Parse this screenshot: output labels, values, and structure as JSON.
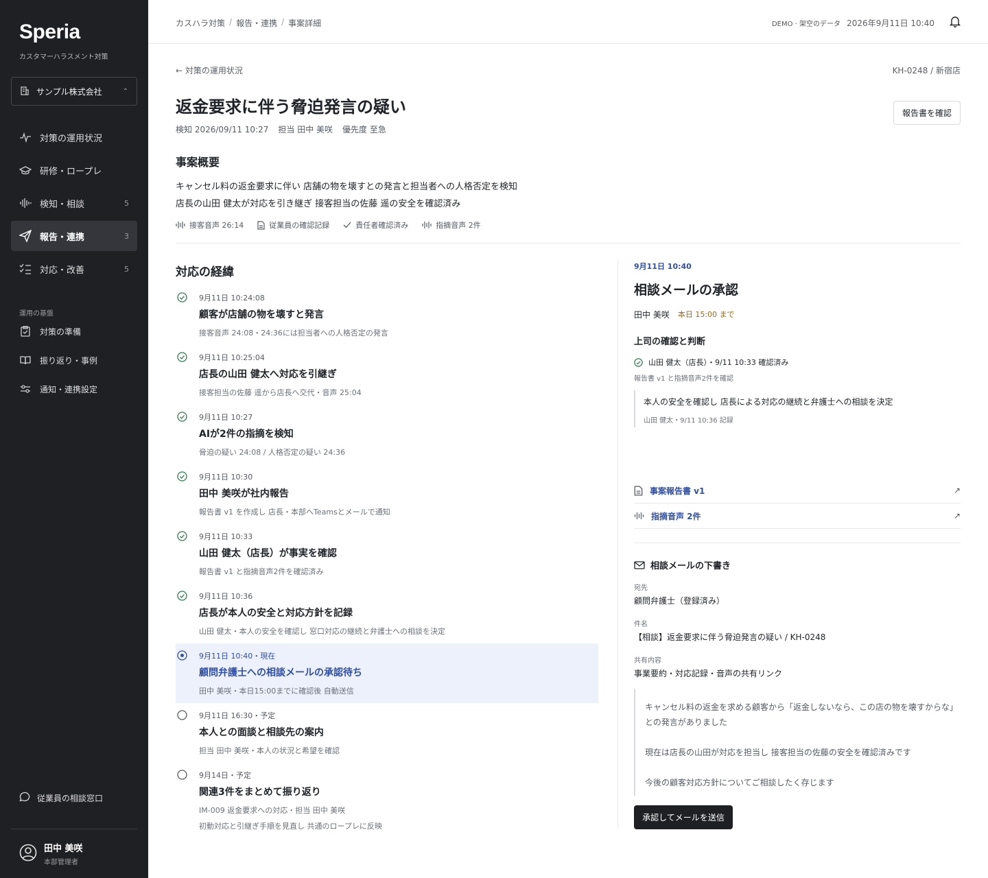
{
  "sidebar": {
    "logo": "Speria",
    "subtitle": "カスタマーハラスメント対策",
    "org": "サンプル株式会社",
    "nav": [
      {
        "label": "対策の運用状況",
        "count": ""
      },
      {
        "label": "研修・ロープレ",
        "count": ""
      },
      {
        "label": "検知・相談",
        "count": "5"
      },
      {
        "label": "報告・連携",
        "count": "3"
      },
      {
        "label": "対応・改善",
        "count": "5"
      }
    ],
    "section_label": "運用の基盤",
    "nav2": [
      {
        "label": "対策の準備"
      },
      {
        "label": "振り返り・事例"
      },
      {
        "label": "通知・連携設定"
      }
    ],
    "consult": "従業員の相談窓口",
    "user": {
      "name": "田中 美咲",
      "role": "本部管理者"
    }
  },
  "header": {
    "breadcrumbs": [
      "カスハラ対策",
      "報告・連携",
      "事案詳細"
    ],
    "demo": "DEMO · 架空のデータ",
    "datetime": "2026年9月11日 10:40"
  },
  "case": {
    "back": "← 対策の運用状況",
    "id": "KH-0248 / 新宿店",
    "title": "返金要求に伴う脅迫発言の疑い",
    "meta": {
      "detected": "検知 2026/09/11 10:27",
      "owner": "担当 田中 美咲",
      "priority": "優先度 至急"
    },
    "report_button": "報告書を確認",
    "summary_heading": "事案概要",
    "summary_lines": [
      "キャンセル料の返金要求に伴い 店舗の物を壊すとの発言と担当者への人格否定を検知",
      "店長の山田 健太が対応を引き継ぎ 接客担当の佐藤 遥の安全を確認済み"
    ],
    "tags": [
      "接客音声 26:14",
      "従業員の確認記録",
      "責任者確認済み",
      "指摘音声 2件"
    ]
  },
  "timeline": {
    "heading": "対応の経緯",
    "events": [
      {
        "time": "9月11日 10:24:08",
        "title": "顧客が店舗の物を壊すと発言",
        "desc": "接客音声 24:08・24:36には担当者への人格否定の発言",
        "status": "done"
      },
      {
        "time": "9月11日 10:25:04",
        "title": "店長の山田 健太へ対応を引継ぎ",
        "desc": "接客担当の佐藤 遥から店長へ交代・音声 25:04",
        "status": "done"
      },
      {
        "time": "9月11日 10:27",
        "title": "AIが2件の指摘を検知",
        "desc": "脅迫の疑い 24:08 / 人格否定の疑い 24:36",
        "status": "done"
      },
      {
        "time": "9月11日 10:30",
        "title": "田中 美咲が社内報告",
        "desc": "報告書 v1 を作成し 店長・本部へTeamsとメールで通知",
        "status": "done"
      },
      {
        "time": "9月11日 10:33",
        "title": "山田 健太（店長）が事実を確認",
        "desc": "報告書 v1 と指摘音声2件を確認済み",
        "status": "done"
      },
      {
        "time": "9月11日 10:36",
        "title": "店長が本人の安全と対応方針を記録",
        "desc": "山田 健太・本人の安全を確認し 窓口対応の継続と弁護士への相談を決定",
        "status": "done"
      },
      {
        "time": "9月11日 10:40・現在",
        "title": "顧問弁護士への相談メールの承認待ち",
        "desc": "田中 美咲・本日15:00までに確認後 自動送信",
        "status": "current"
      },
      {
        "time": "9月11日 16:30・予定",
        "title": "本人との面談と相談先の案内",
        "desc": "担当 田中 美咲・本人の状況と希望を確認",
        "status": "planned"
      },
      {
        "time": "9月14日・予定",
        "title": "関連3件をまとめて振り返り",
        "desc": "IM-009 返金要求への対応・担当 田中 美咲",
        "desc2": "初動対応と引継ぎ手順を見直し 共通のロープレに反映",
        "status": "planned"
      }
    ]
  },
  "panel": {
    "date": "9月11日 10:40",
    "title": "相談メールの承認",
    "assignee": "田中 美咲",
    "due": "本日 15:00 まで",
    "section": "上司の確認と判断",
    "confirm": "山田 健太（店長）・9/11 10:33 確認済み",
    "confirm_sub": "報告書 v1 と指摘音声2件を確認",
    "quote": "本人の安全を確認し 店長による対応の継続と弁護士への相談を決定",
    "quote_meta": "山田 健太・9/11 10:36 記録",
    "links": [
      "事案報告書 v1",
      "指摘音声 2件"
    ],
    "mail_heading": "相談メールの下書き",
    "to_label": "宛先",
    "to": "顧問弁護士（登録済み）",
    "subject_label": "件名",
    "subject": "【相談】返金要求に伴う脅迫発言の疑い / KH-0248",
    "share_label": "共有内容",
    "share": "事業要約・対応記録・音声の共有リンク",
    "body": [
      "キャンセル料の返金を求める顧客から「返金しないなら、この店の物を壊すからな」との発言がありました",
      "現在は店長の山田が対応を担当し 接客担当の佐藤の安全を確認済みです",
      "今後の顧客対応方針についてご相談したく存じます"
    ],
    "send_button": "承認してメールを送信"
  },
  "colors": {
    "sidebar_bg": "#1f2024",
    "accent": "#2f4fa6",
    "done": "#2e7d4f",
    "due": "#9a6a12",
    "current_bg": "#edf1fc"
  }
}
